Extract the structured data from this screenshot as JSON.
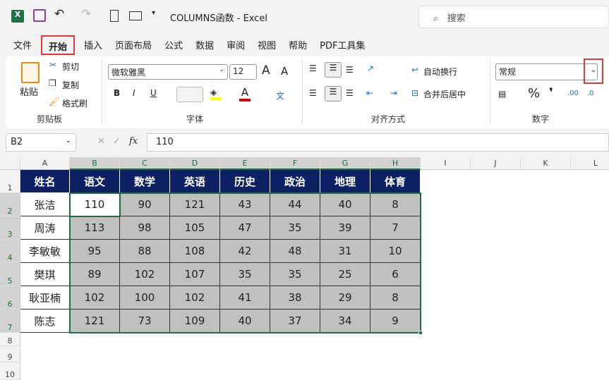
{
  "title": {
    "doc": "COLUMNS函数  -  Excel",
    "search": "搜索"
  },
  "tabs": [
    "文件",
    "开始",
    "插入",
    "页面布局",
    "公式",
    "数据",
    "审阅",
    "视图",
    "帮助",
    "PDF工具集"
  ],
  "ribbon": {
    "clipboard": {
      "paste": "粘贴",
      "cut": "剪切",
      "copy": "复制",
      "format_painter": "格式刷",
      "label": "剪贴板"
    },
    "font": {
      "name": "微软雅黑",
      "size": "12",
      "bold": "B",
      "italic": "I",
      "underline": "U",
      "label": "字体",
      "font_color": "A",
      "grow": "A",
      "shrink": "A",
      "phonetic": "文"
    },
    "alignment": {
      "wrap": "自动换行",
      "merge": "合并后居中",
      "label": "对齐方式"
    },
    "number": {
      "format": "常规",
      "percent": "%",
      "comma": "❜",
      "label": "数字",
      "inc": ".00",
      "dec": ".0"
    }
  },
  "formula_bar": {
    "name_box": "B2",
    "fx": "fx",
    "value": "110"
  },
  "columns": [
    "A",
    "B",
    "C",
    "D",
    "E",
    "F",
    "G",
    "H",
    "I",
    "J",
    "K",
    "L"
  ],
  "rows": [
    "1",
    "2",
    "3",
    "4",
    "5",
    "6",
    "7",
    "8",
    "9",
    "10"
  ],
  "table": {
    "headers": [
      "姓名",
      "语文",
      "数学",
      "英语",
      "历史",
      "政治",
      "地理",
      "体育"
    ],
    "rows": [
      [
        "张洁",
        "110",
        "90",
        "121",
        "43",
        "44",
        "40",
        "8"
      ],
      [
        "周涛",
        "113",
        "98",
        "105",
        "47",
        "35",
        "39",
        "7"
      ],
      [
        "李敏敏",
        "95",
        "88",
        "108",
        "42",
        "48",
        "31",
        "10"
      ],
      [
        "樊琪",
        "89",
        "102",
        "107",
        "35",
        "35",
        "25",
        "6"
      ],
      [
        "耿亚楠",
        "102",
        "100",
        "102",
        "41",
        "38",
        "29",
        "8"
      ],
      [
        "陈志",
        "121",
        "73",
        "109",
        "40",
        "37",
        "34",
        "9"
      ]
    ]
  }
}
